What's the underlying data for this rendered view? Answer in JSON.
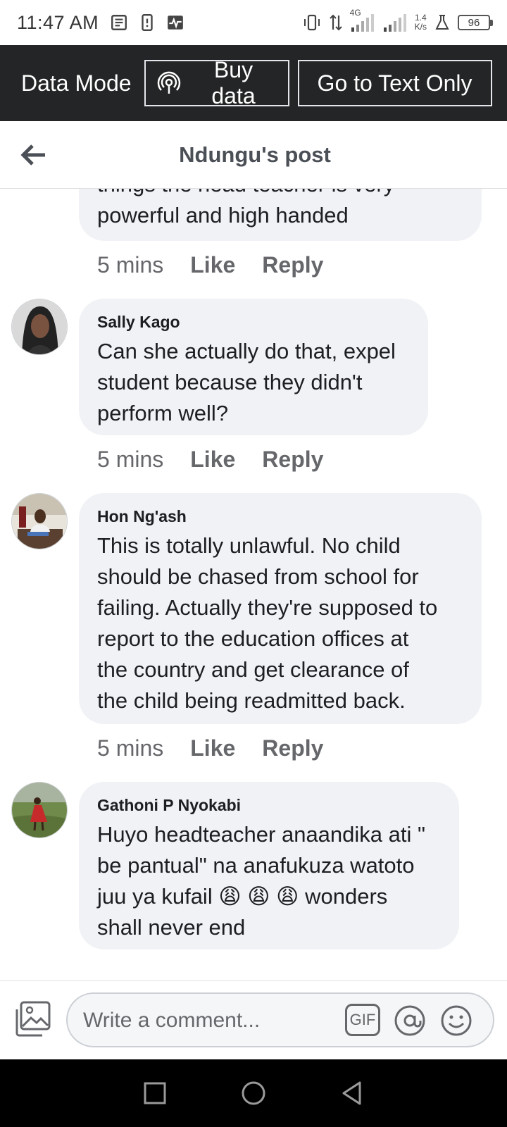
{
  "status_bar": {
    "time": "11:47 AM",
    "network": "4G",
    "speed_value": "1.4",
    "speed_unit": "K/s",
    "battery": "96"
  },
  "data_bar": {
    "mode_label": "Data Mode",
    "buy_label": "Buy data",
    "text_only_label": "Go to Text Only"
  },
  "header": {
    "title": "Ndungu's post"
  },
  "partial_comment": {
    "text_cut": "things the head teacher is very",
    "text": "powerful and high handed",
    "time": "5 mins",
    "like": "Like",
    "reply": "Reply"
  },
  "comments": [
    {
      "author": "Sally Kago",
      "lines": [
        "Can she actually do that, expel",
        "student because they didn't",
        "perform well?"
      ],
      "time": "5 mins",
      "like": "Like",
      "reply": "Reply"
    },
    {
      "author": "Hon Ng'ash",
      "lines": [
        "This is totally unlawful. No child",
        "should be chased from school for",
        "failing. Actually they're supposed to",
        "report to the education offices at",
        "the country and get clearance of",
        "the child being readmitted back."
      ],
      "time": "5 mins",
      "like": "Like",
      "reply": "Reply"
    },
    {
      "author": "Gathoni P Nyokabi",
      "lines": [
        "Huyo headteacher anaandika ati \"",
        "be pantual\" na anafukuza watoto",
        "juu ya kufail 😩 😩 😩  wonders",
        "shall never end"
      ],
      "time": "",
      "like": "",
      "reply": ""
    }
  ],
  "composer": {
    "placeholder": "Write a comment...",
    "gif_label": "GIF"
  },
  "icons": {
    "back": "arrow-left-icon",
    "photo": "photo-icon",
    "gif": "gif-icon",
    "mention": "at-icon",
    "emoji": "smiley-icon"
  }
}
